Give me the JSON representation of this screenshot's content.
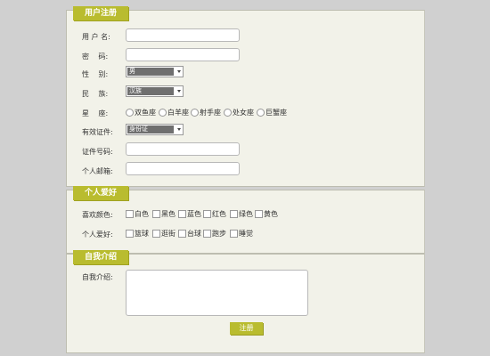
{
  "sections": {
    "register": "用户注册",
    "hobbies": "个人爱好",
    "intro": "自我介绍"
  },
  "form": {
    "username_label": "用 户 名:",
    "password_label": "密　 码:",
    "gender_label": "性　 别:",
    "gender_value": "男",
    "ethnicity_label": "民　 族:",
    "ethnicity_value": "汉族",
    "zodiac_label": "星　 座:",
    "zodiac_options": [
      "双鱼座",
      "白羊座",
      "射手座",
      "处女座",
      "巨蟹座"
    ],
    "id_type_label": "有效证件:",
    "id_type_value": "身份证",
    "id_number_label": "证件号码:",
    "email_label": "个人邮箱:"
  },
  "hobbies": {
    "colors_label": "喜欢颜色:",
    "colors": [
      "白色",
      "黑色",
      "蓝色",
      "红色",
      "绿色",
      "黄色"
    ],
    "hobby_label": "个人爱好:",
    "hobbies": [
      "篮球",
      "逛街",
      "台球",
      "跑步",
      "睡觉"
    ]
  },
  "intro": {
    "label": "自我介绍:",
    "submit": "注册"
  }
}
